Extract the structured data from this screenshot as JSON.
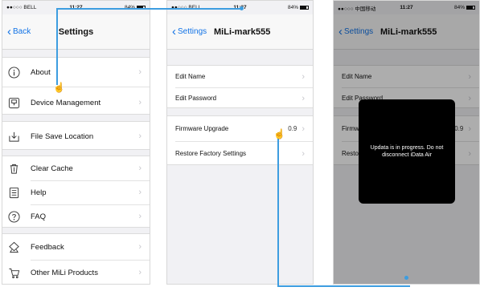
{
  "screen1": {
    "status": {
      "carrier": "●●○○○ BELL",
      "time": "11:27",
      "battery": "84%"
    },
    "back_label": "Back",
    "title": "Settings",
    "items": [
      {
        "label": "About",
        "icon": "info-icon"
      },
      {
        "label": "Device Management",
        "icon": "device-icon"
      },
      {
        "label": "File Save Location",
        "icon": "download-icon"
      },
      {
        "label": "Clear Cache",
        "icon": "trash-icon"
      },
      {
        "label": "Help",
        "icon": "document-icon"
      },
      {
        "label": "FAQ",
        "icon": "question-icon"
      },
      {
        "label": "Feedback",
        "icon": "feedback-icon"
      },
      {
        "label": "Other MiLi Products",
        "icon": "cart-icon"
      }
    ]
  },
  "screen2": {
    "status": {
      "carrier": "●●○○○ BELL",
      "time": "11:27",
      "battery": "84%"
    },
    "back_label": "Settings",
    "title": "MiLi-mark555",
    "items": [
      {
        "label": "Edit Name"
      },
      {
        "label": "Edit Password"
      },
      {
        "label": "Firmware Upgrade",
        "value": "0.9"
      },
      {
        "label": "Restore Factory Settings"
      }
    ]
  },
  "screen3": {
    "status": {
      "carrier": "●●○○○ 中国移动",
      "time": "11:27",
      "battery": "84%"
    },
    "back_label": "Settings",
    "title": "MiLi-mark555",
    "items": [
      {
        "label": "Edit Name"
      },
      {
        "label": "Edit Password"
      },
      {
        "label": "Firmware",
        "value": "0.9"
      },
      {
        "label": "Resto"
      }
    ],
    "modal_text": "Updata is in progress. Do not disconnect iData Air"
  },
  "colors": {
    "accent": "#1273e6",
    "callout": "#3d9de0"
  }
}
